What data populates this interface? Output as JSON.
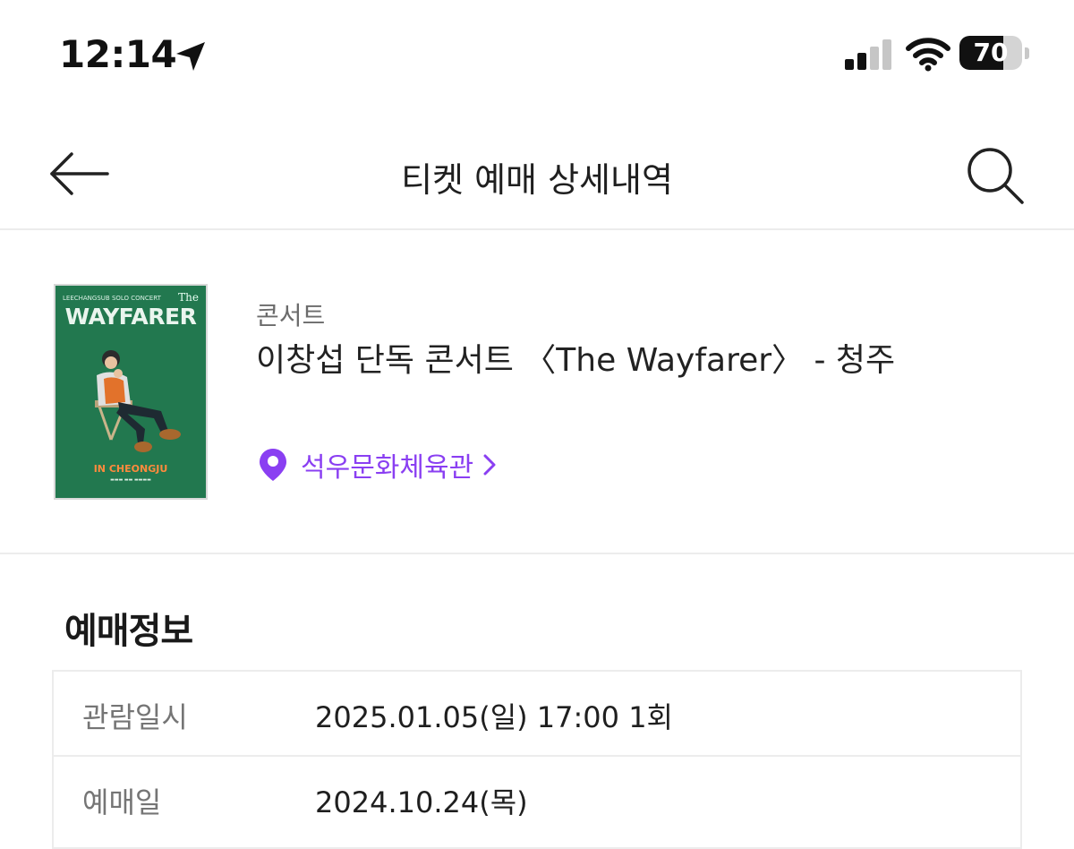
{
  "status_bar": {
    "time": "12:14",
    "battery_percent": "70",
    "battery_level": 0.7,
    "signal_bars_active": 2,
    "signal_bars_total": 4
  },
  "header": {
    "title": "티켓 예매 상세내역"
  },
  "event": {
    "category": "콘서트",
    "title": "이창섭 단독 콘서트 〈The Wayfarer〉 - 청주",
    "venue": "석우문화체육관",
    "poster": {
      "top_text": "LEECHANGSUB SOLO CONCERT",
      "the_text": "The",
      "title_text": "WAYFARER",
      "subtitle_text": "IN CHEONGJU"
    }
  },
  "booking_info": {
    "heading": "예매정보",
    "rows": [
      {
        "label": "관람일시",
        "value": "2025.01.05(일) 17:00 1회"
      },
      {
        "label": "예매일",
        "value": "2024.10.24(목)"
      }
    ]
  },
  "colors": {
    "accent": "#8a3ff2",
    "poster_green": "#22784f",
    "divider": "#ececec"
  },
  "icons": [
    "location-arrow-icon",
    "signal-icon",
    "wifi-icon",
    "battery-icon",
    "back-arrow-icon",
    "search-icon",
    "map-pin-icon",
    "chevron-right-icon"
  ]
}
